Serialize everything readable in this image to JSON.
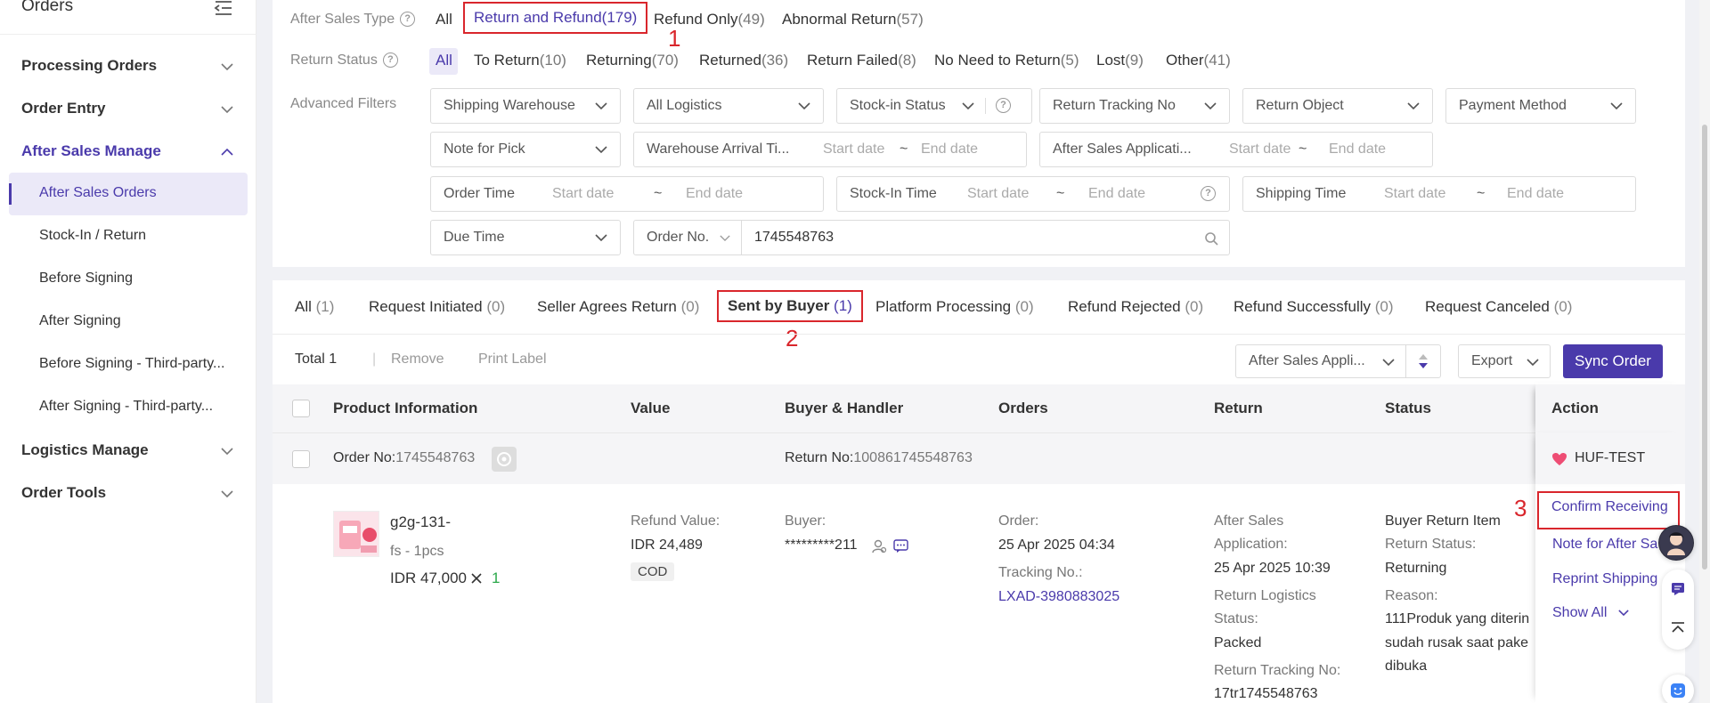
{
  "sidebar": {
    "title": "Orders",
    "groups": [
      {
        "label": "Processing Orders"
      },
      {
        "label": "Order Entry"
      },
      {
        "label": "After Sales Manage"
      },
      {
        "label": "Logistics Manage"
      },
      {
        "label": "Order Tools"
      }
    ],
    "items": [
      {
        "label": "After Sales Orders"
      },
      {
        "label": "Stock-In / Return"
      },
      {
        "label": "Before Signing"
      },
      {
        "label": "After Signing"
      },
      {
        "label": "Before Signing - Third-party..."
      },
      {
        "label": "After Signing - Third-party..."
      }
    ]
  },
  "filters": {
    "after_sales_type": {
      "label": "After Sales Type",
      "options": [
        {
          "label": "All",
          "count": ""
        },
        {
          "label": "Return and Refund",
          "count": "(179)"
        },
        {
          "label": "Refund Only",
          "count": "(49)"
        },
        {
          "label": "Abnormal Return",
          "count": "(57)"
        }
      ]
    },
    "return_status": {
      "label": "Return Status",
      "options": [
        {
          "label": "All",
          "count": ""
        },
        {
          "label": "To Return",
          "count": "(10)"
        },
        {
          "label": "Returning",
          "count": "(70)"
        },
        {
          "label": "Returned",
          "count": "(36)"
        },
        {
          "label": "Return Failed",
          "count": "(8)"
        },
        {
          "label": "No Need to Return",
          "count": "(5)"
        },
        {
          "label": "Lost",
          "count": "(9)"
        },
        {
          "label": "Other",
          "count": "(41)"
        }
      ]
    },
    "advanced_label": "Advanced Filters",
    "selects": {
      "shipping_warehouse": "Shipping Warehouse",
      "all_logistics": "All Logistics",
      "stockin_status": "Stock-in Status",
      "return_tracking": "Return Tracking No",
      "return_object": "Return Object",
      "payment_method": "Payment Method",
      "note_for_pick": "Note for Pick",
      "due_time": "Due Time",
      "order_no": "Order No."
    },
    "dates": {
      "warehouse_arrival": "Warehouse Arrival Ti...",
      "after_sales_app": "After Sales Applicati...",
      "order_time": "Order Time",
      "stockin_time": "Stock-In Time",
      "shipping_time": "Shipping Time",
      "start": "Start date",
      "end": "End date",
      "tilde": "~"
    },
    "order_no_value": "1745548763"
  },
  "tabs": [
    {
      "label": "All",
      "count": "(1)"
    },
    {
      "label": "Request Initiated",
      "count": "(0)"
    },
    {
      "label": "Seller Agrees Return",
      "count": "(0)"
    },
    {
      "label": "Sent by Buyer",
      "count": "(1)"
    },
    {
      "label": "Platform Processing",
      "count": "(0)"
    },
    {
      "label": "Refund Rejected",
      "count": "(0)"
    },
    {
      "label": "Refund Successfully",
      "count": "(0)"
    },
    {
      "label": "Request Canceled",
      "count": "(0)"
    }
  ],
  "toolbar": {
    "total": "Total 1",
    "sep": "|",
    "remove": "Remove",
    "print_label": "Print Label",
    "sort_select": "After Sales Appli...",
    "export": "Export",
    "sync": "Sync Order"
  },
  "table": {
    "headers": [
      "Product Information",
      "Value",
      "Buyer & Handler",
      "Orders",
      "Return",
      "Status",
      "Action"
    ],
    "order_row": {
      "order_no_label": "Order No:",
      "order_no": "1745548763",
      "return_no_label": "Return No:",
      "return_no": "100861745548763",
      "shop": "HUF-TEST"
    },
    "item": {
      "name": "g2g-131-",
      "variant": "fs - 1pcs",
      "price": "IDR 47,000",
      "qty": "1",
      "refund_label": "Refund Value:",
      "refund": "IDR 24,489",
      "payment": "COD",
      "buyer_label": "Buyer:",
      "buyer": "*********211",
      "order_label": "Order:",
      "order_time": "25 Apr 2025 04:34",
      "tracking_label": "Tracking No.:",
      "tracking": "LXAD-3980883025",
      "return_lines": [
        "After Sales",
        "Application:",
        "25 Apr 2025 10:39",
        "Return Logistics",
        "Status:",
        "Packed",
        "Return Tracking No:",
        "17tr1745548763"
      ],
      "status_lines": [
        "Buyer Return Item",
        "Return Status:",
        "Returning",
        "Reason:",
        "111Produk yang diterin",
        "sudah rusak saat pake",
        "dibuka"
      ],
      "actions": [
        "Confirm Receiving",
        "Note for After Sa",
        "Reprint Shipping",
        "Show All"
      ]
    }
  },
  "annotations": [
    "1",
    "2",
    "3"
  ],
  "colors": {
    "accent": "#4a3aab",
    "annotation": "#d9262c"
  }
}
